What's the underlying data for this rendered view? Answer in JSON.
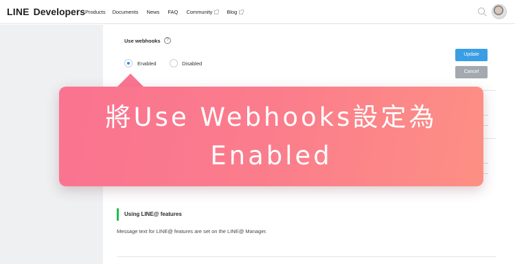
{
  "header": {
    "logo_bold": "LINE",
    "logo_rest": "Developers",
    "nav": [
      {
        "label": "Products",
        "external": false
      },
      {
        "label": "Documents",
        "external": false
      },
      {
        "label": "News",
        "external": false
      },
      {
        "label": "FAQ",
        "external": false
      },
      {
        "label": "Community",
        "external": true
      },
      {
        "label": "Blog",
        "external": true
      }
    ],
    "icons": {
      "search": "search-icon",
      "avatar": "user-avatar",
      "external": "external-link-icon"
    }
  },
  "webhooks": {
    "label": "Use webhooks",
    "help": "?",
    "options": [
      {
        "label": "Enabled",
        "selected": true
      },
      {
        "label": "Disabled",
        "selected": false
      }
    ],
    "update_label": "Update",
    "cancel_label": "Cancel"
  },
  "line_at": {
    "title": "Using LINE@ features",
    "description": "Message text for LINE@ features are set on the LINE@ Manager."
  },
  "callout": {
    "line1": "將Use Webhooks設定為",
    "line2": "Enabled"
  },
  "colors": {
    "accent": "#3a9ee4",
    "section_bar": "#1dbf4a",
    "callout_start": "#fa7390",
    "callout_end": "#fd8f84"
  }
}
